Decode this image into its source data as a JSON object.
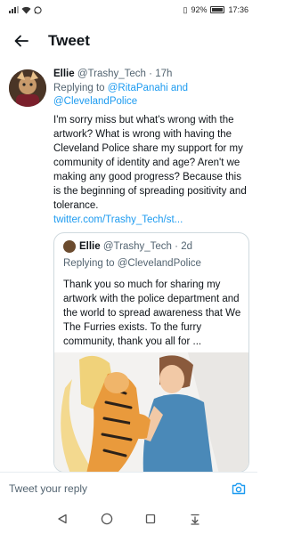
{
  "status_bar": {
    "left_indicators": "ıll ᯤ ◔",
    "vibrate": "▯",
    "battery_percent": "92%",
    "time": "17:36"
  },
  "header": {
    "title": "Tweet",
    "back_icon": "arrow-left-icon"
  },
  "reply_tweet": {
    "display_name": "Ellie",
    "handle": "@Trashy_Tech",
    "separator": "·",
    "time": "17h",
    "replying_prefix": "Replying to",
    "replying_to": "@RitaPanahi and @ClevelandPolice",
    "text": "I'm sorry miss but what's wrong with the artwork? What is wrong with having the Cleveland Police share my support for my community of identity and age? Aren't we making any good progress? Because this is the beginning of spreading positivity and tolerance.",
    "link": "twitter.com/Trashy_Tech/st..."
  },
  "quoted_tweet": {
    "display_name": "Ellie",
    "handle": "@Trashy_Tech",
    "separator": "·",
    "time": "2d",
    "replying_prefix": "Replying to",
    "replying_to": "@ClevelandPolice",
    "text": "Thank you so much for sharing my artwork with the police department and the world to spread awareness that We The Furries exists. To the furry community, thank you all for ..."
  },
  "reply_bar": {
    "placeholder": "Tweet your reply",
    "camera_icon": "camera-icon"
  },
  "nav_bar": {
    "icons": [
      "back-triangle-icon",
      "home-circle-icon",
      "recents-square-icon",
      "notifications-pulldown-icon"
    ]
  },
  "colors": {
    "link": "#1d9bf0",
    "text": "#0f1419",
    "secondary": "#536471",
    "border": "#cfd9de"
  }
}
